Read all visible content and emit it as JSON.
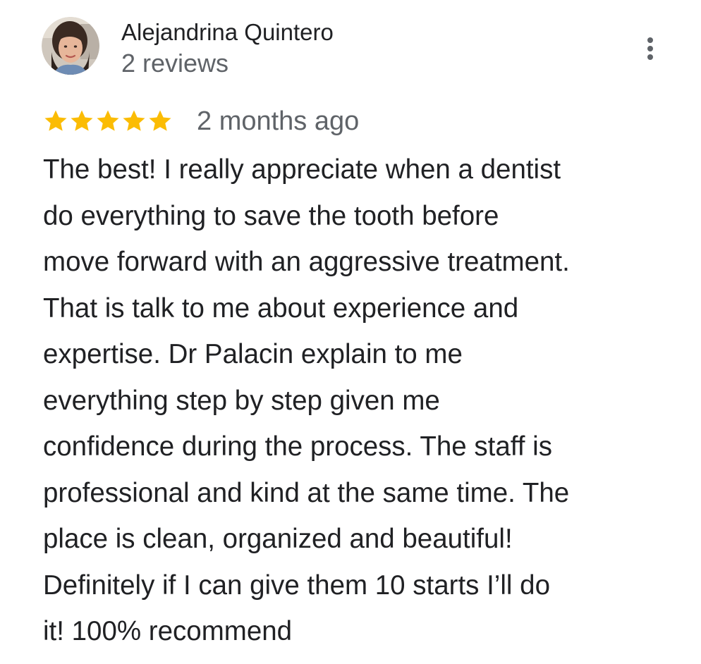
{
  "author": {
    "name": "Alejandrina Quintero",
    "reviews_count": "2 reviews",
    "avatar_icon": "profile-photo"
  },
  "menu": {
    "icon": "more-vertical-icon"
  },
  "review": {
    "rating": 5,
    "rating_max": 5,
    "star_color": "#fbbc04",
    "date": "2 months ago",
    "lines": [
      "The best! I really appreciate when a dentist",
      "do everything to save the tooth before",
      "move forward with an aggressive treatment.",
      "That is talk to me about experience and",
      "expertise. Dr Palacin explain to me",
      "everything step by step given me",
      "confidence during the process. The staff is",
      "professional and kind at the same time. The",
      "place is clean, organized and beautiful!",
      "Definitely if I can give them 10 starts I’ll do",
      "it! 100% recommend"
    ]
  }
}
